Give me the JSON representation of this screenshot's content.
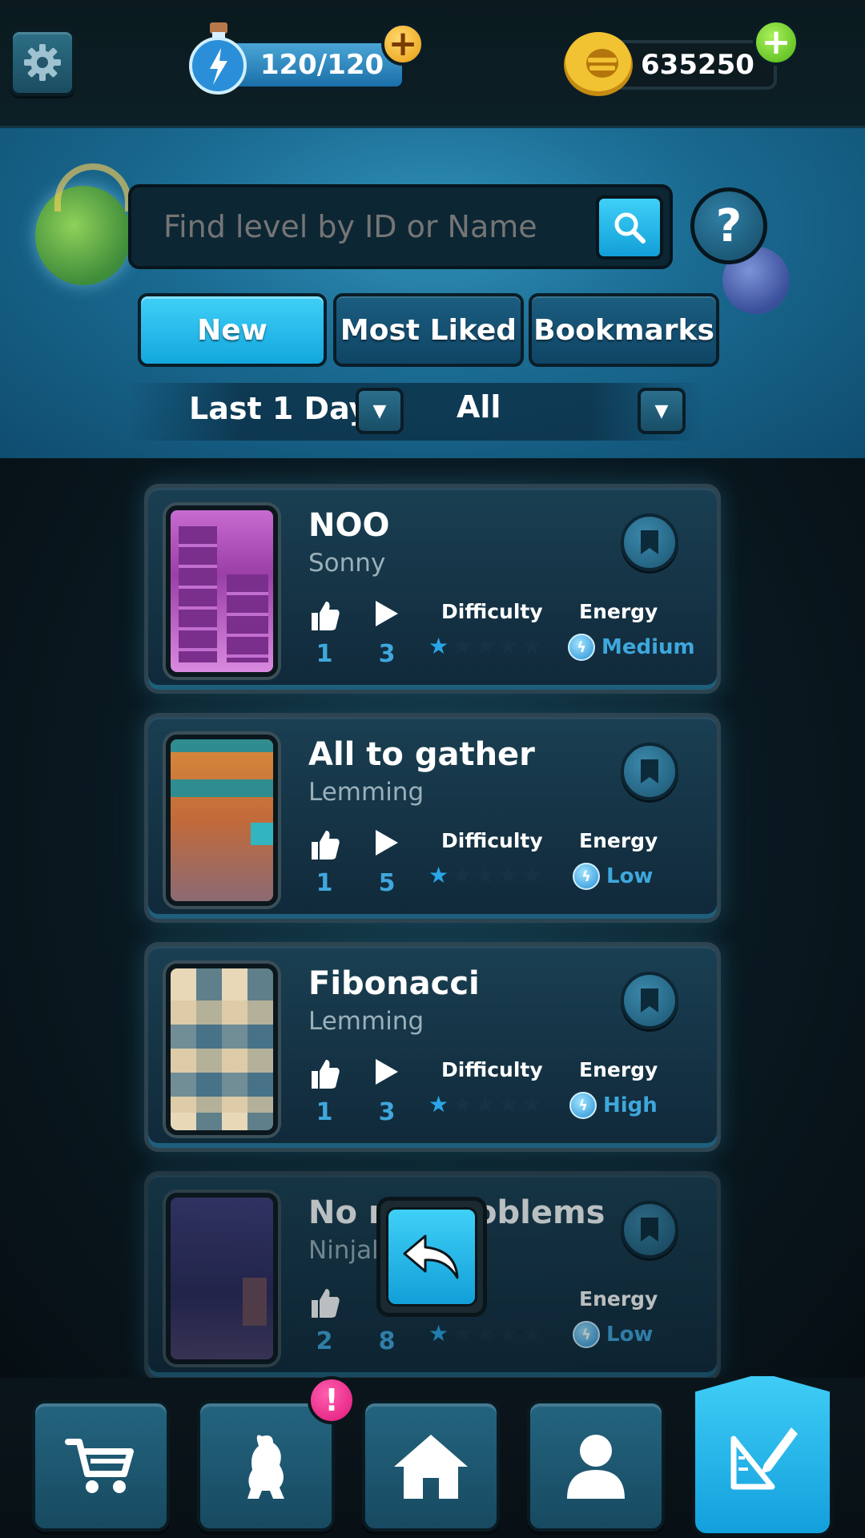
{
  "top": {
    "energy_text": "120/120",
    "coins_text": "635250"
  },
  "search": {
    "placeholder": "Find level by ID or Name"
  },
  "tabs": [
    {
      "label": "New",
      "active": true
    },
    {
      "label": "Most Liked",
      "active": false
    },
    {
      "label": "Bookmarks",
      "active": false
    }
  ],
  "filters": {
    "time_value": "Last 1 Day",
    "type_value": "All"
  },
  "labels": {
    "difficulty": "Difficulty",
    "energy": "Energy"
  },
  "levels": [
    {
      "title": "NOO",
      "author": "Sonny",
      "likes": "1",
      "plays": "3",
      "difficulty_stars": 1,
      "energy": "Medium"
    },
    {
      "title": "All to gather",
      "author": "Lemming",
      "likes": "1",
      "plays": "5",
      "difficulty_stars": 1,
      "energy": "Low"
    },
    {
      "title": "Fibonacci",
      "author": "Lemming",
      "likes": "1",
      "plays": "3",
      "difficulty_stars": 1,
      "energy": "High"
    },
    {
      "title": "No n",
      "title_tail": "oblems",
      "author": "Ninjal",
      "likes": "2",
      "plays": "8",
      "difficulty_stars": 1,
      "energy": "Low"
    }
  ],
  "notification_badge": "!",
  "colors": {
    "accent": "#13a7de",
    "coin": "#f1c232",
    "plus_green": "#6bd51c",
    "plus_orange": "#f6b21e"
  }
}
